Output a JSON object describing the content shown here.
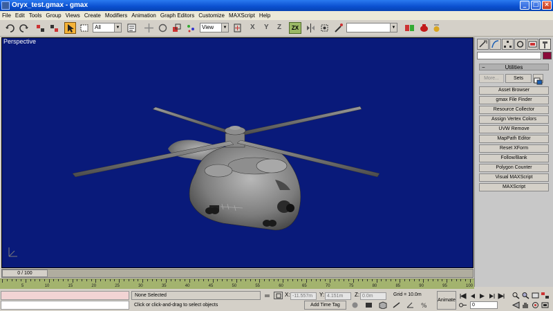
{
  "window": {
    "title": "Oryx_test.gmax - gmax"
  },
  "menu": [
    "File",
    "Edit",
    "Tools",
    "Group",
    "Views",
    "Create",
    "Modifiers",
    "Animation",
    "Graph Editors",
    "Customize",
    "MAXScript",
    "Help"
  ],
  "toolbar": {
    "selection_filter": "All",
    "coord_system": "View",
    "axis_x": "X",
    "axis_y": "Y",
    "axis_z": "Z",
    "axis_plane": "ZX",
    "named_selection": ""
  },
  "viewport": {
    "label": "Perspective",
    "background": "#091a7a"
  },
  "command_panel": {
    "rollout_title": "Utilities",
    "more_label": "More...",
    "sets_label": "Sets",
    "utilities": [
      "Asset Browser",
      "gmax File Finder",
      "Resource Collector",
      "Assign Vertex Colors",
      "UVW Remove",
      "MapPath Editor",
      "Reset XForm",
      "Follow/Bank",
      "Polygon Counter",
      "Visual MAXScript",
      "MAXScript"
    ]
  },
  "timeline": {
    "slider_label": "0 / 100",
    "ticks": [
      "5",
      "10",
      "15",
      "20",
      "25",
      "30",
      "35",
      "40",
      "45",
      "50",
      "55",
      "60",
      "65",
      "70",
      "75",
      "80",
      "85",
      "90",
      "95",
      "100"
    ]
  },
  "status": {
    "selection": "None Selected",
    "prompt": "Click or click-and-drag to select objects",
    "x_label": "X:",
    "x_value": "-11.557m",
    "y_label": "Y:",
    "y_value": "4.151m",
    "z_label": "Z:",
    "z_value": "0.0m",
    "grid": "Grid = 10.0m",
    "add_time_tag": "Add Time Tag",
    "animate": "Animate",
    "frame": "0"
  }
}
